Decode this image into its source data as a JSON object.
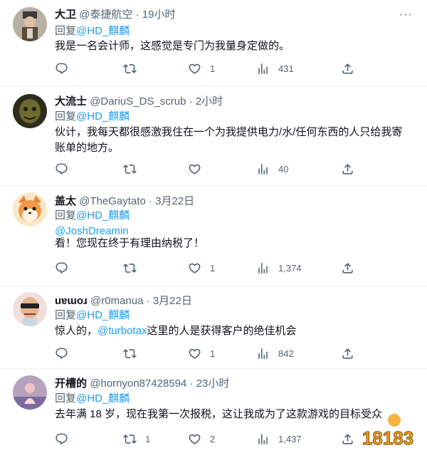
{
  "tweets": [
    {
      "name": "大卫",
      "handle": "@泰捷航空",
      "time": "19小时",
      "reply_prefix": "回复",
      "reply_to": "@HD_麒麟",
      "text": "我是一名会计师，这感觉是专门为我量身定做的。",
      "replies": "",
      "retweets": "",
      "likes": "1",
      "views": "431"
    },
    {
      "name": "大流士",
      "handle": "@DariuS_DS_scrub",
      "time": "2小时",
      "reply_prefix": "回复",
      "reply_to": "@HD_麒麟",
      "text": "伙计，我每天都很感激我住在一个为我提供电力/水/任何东西的人只给我寄账单的地方。",
      "replies": "",
      "retweets": "",
      "likes": "",
      "views": "40"
    },
    {
      "name": "盖太",
      "handle": "@TheGaytato",
      "time": "3月22日",
      "reply_prefix": "回复",
      "reply_to": "@HD_麒麟",
      "mention": "@JoshDreamin",
      "text": "看！您现在终于有理由纳税了！",
      "replies": "",
      "retweets": "",
      "likes": "1",
      "views": "1,374"
    },
    {
      "name": "uɐɯoɹ",
      "handle": "@r0manua",
      "time": "3月22日",
      "reply_prefix": "回复",
      "reply_to": "@HD_麒麟",
      "text_before": "惊人的，",
      "text_link": "@turbotax",
      "text_after": "这里的人是获得客户的绝佳机会",
      "replies": "",
      "retweets": "",
      "likes": "1",
      "views": "842"
    },
    {
      "name": "开槽的",
      "handle": "@hornyon87428594",
      "time": "23小时",
      "reply_prefix": "回复",
      "reply_to": "@HD_麒麟",
      "text": "去年满 18 岁，现在我第一次报税，这让我成为了这款游戏的目标受众",
      "replies": "",
      "retweets": "1",
      "likes": "2",
      "views": "1,437"
    }
  ],
  "separator": "·",
  "more_glyph": "···",
  "watermark": "18183",
  "colors": {
    "text": "#0f1419",
    "muted": "#536471",
    "link": "#1d9bf0",
    "divider": "#eff3f4",
    "watermark": "#f5a623"
  }
}
